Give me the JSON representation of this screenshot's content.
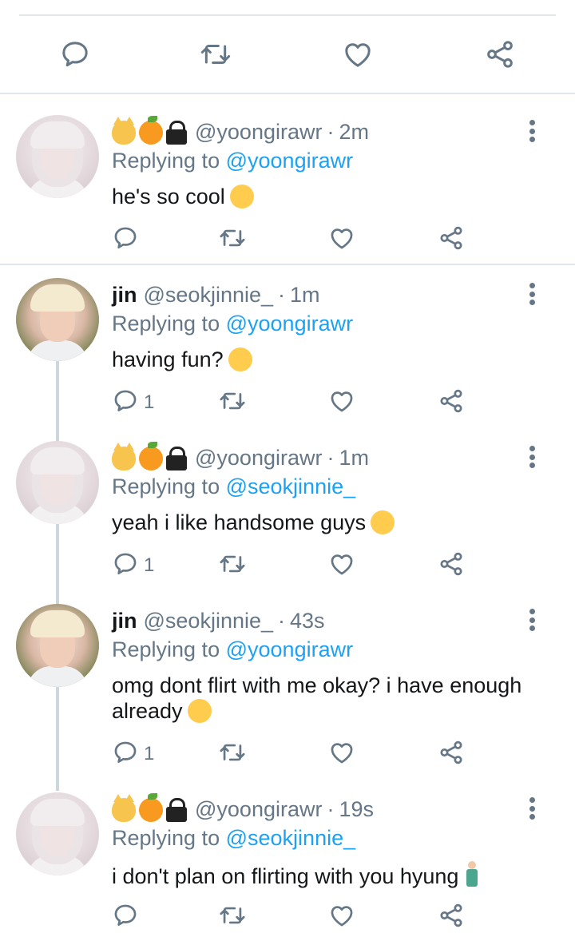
{
  "tweets": [
    {
      "author": "yoongi",
      "display_name": "",
      "handle": "@yoongirawr",
      "time": "2m",
      "replying_label": "Replying to",
      "replying_to": "@yoongirawr",
      "text": "he's so cool",
      "reply_count": ""
    },
    {
      "author": "jin",
      "display_name": "jin",
      "handle": "@seokjinnie_",
      "time": "1m",
      "replying_label": "Replying to",
      "replying_to": "@yoongirawr",
      "text": "having fun?",
      "reply_count": "1"
    },
    {
      "author": "yoongi",
      "display_name": "",
      "handle": "@yoongirawr",
      "time": "1m",
      "replying_label": "Replying to",
      "replying_to": "@seokjinnie_",
      "text": "yeah i like handsome guys",
      "reply_count": "1"
    },
    {
      "author": "jin",
      "display_name": "jin",
      "handle": "@seokjinnie_",
      "time": "43s",
      "replying_label": "Replying to",
      "replying_to": "@yoongirawr",
      "text": "omg dont flirt with me okay? i have enough already",
      "reply_count": "1"
    },
    {
      "author": "yoongi",
      "display_name": "",
      "handle": "@yoongirawr",
      "time": "19s",
      "replying_label": "Replying to",
      "replying_to": "@seokjinnie_",
      "text": "i don't plan on flirting with you hyung",
      "reply_count": ""
    }
  ],
  "separator": "·",
  "icons": {
    "name_emoji": [
      "cat-emoji-icon",
      "tangerine-emoji-icon",
      "lock-icon"
    ],
    "actions": [
      "reply-icon",
      "retweet-icon",
      "like-icon",
      "share-icon"
    ],
    "more": "more-vertical-icon",
    "body_emoji": [
      "smiling-face-icon",
      "hand-over-mouth-face-icon",
      "savoring-face-icon",
      "sneezing-face-icon",
      "person-standing-icon"
    ]
  },
  "colors": {
    "icon": "#657786",
    "link": "#1da1f2",
    "text": "#14171a",
    "divider": "#e1e8ed"
  }
}
